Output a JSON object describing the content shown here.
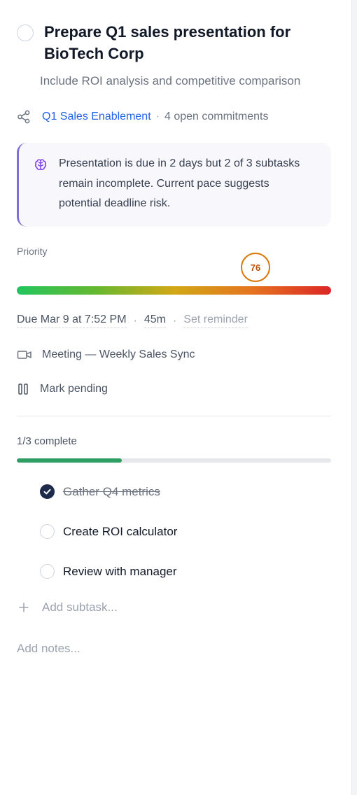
{
  "task": {
    "title": "Prepare Q1 sales presentation for BioTech Corp",
    "description": "Include ROI analysis and competitive comparison"
  },
  "project": {
    "name": "Q1 Sales Enablement",
    "separator": "·",
    "commitments": "4 open commitments"
  },
  "insight": {
    "text": "Presentation is due in 2 days but 2 of 3 subtasks remain incomplete. Current pace suggests potential deadline risk."
  },
  "priority": {
    "label": "Priority",
    "score": "76",
    "value": 76,
    "scale_colors": [
      "#22c55e",
      "#d1a815",
      "#dc2626"
    ]
  },
  "schedule": {
    "due": "Due Mar 9 at 7:52 PM",
    "separator": "·",
    "duration": "45m",
    "reminder": "Set reminder"
  },
  "meeting": {
    "label": "Meeting — Weekly Sales Sync",
    "icon": "video-camera-icon"
  },
  "status": {
    "label": "Mark pending",
    "icon": "pause-icon"
  },
  "progress": {
    "label": "1/3 complete",
    "fraction": 0.3333
  },
  "subtasks": [
    {
      "label": "Gather Q4 metrics",
      "done": true
    },
    {
      "label": "Create ROI calculator",
      "done": false
    },
    {
      "label": "Review with manager",
      "done": false
    }
  ],
  "add_subtask": {
    "placeholder": "Add subtask..."
  },
  "notes": {
    "placeholder": "Add notes..."
  }
}
